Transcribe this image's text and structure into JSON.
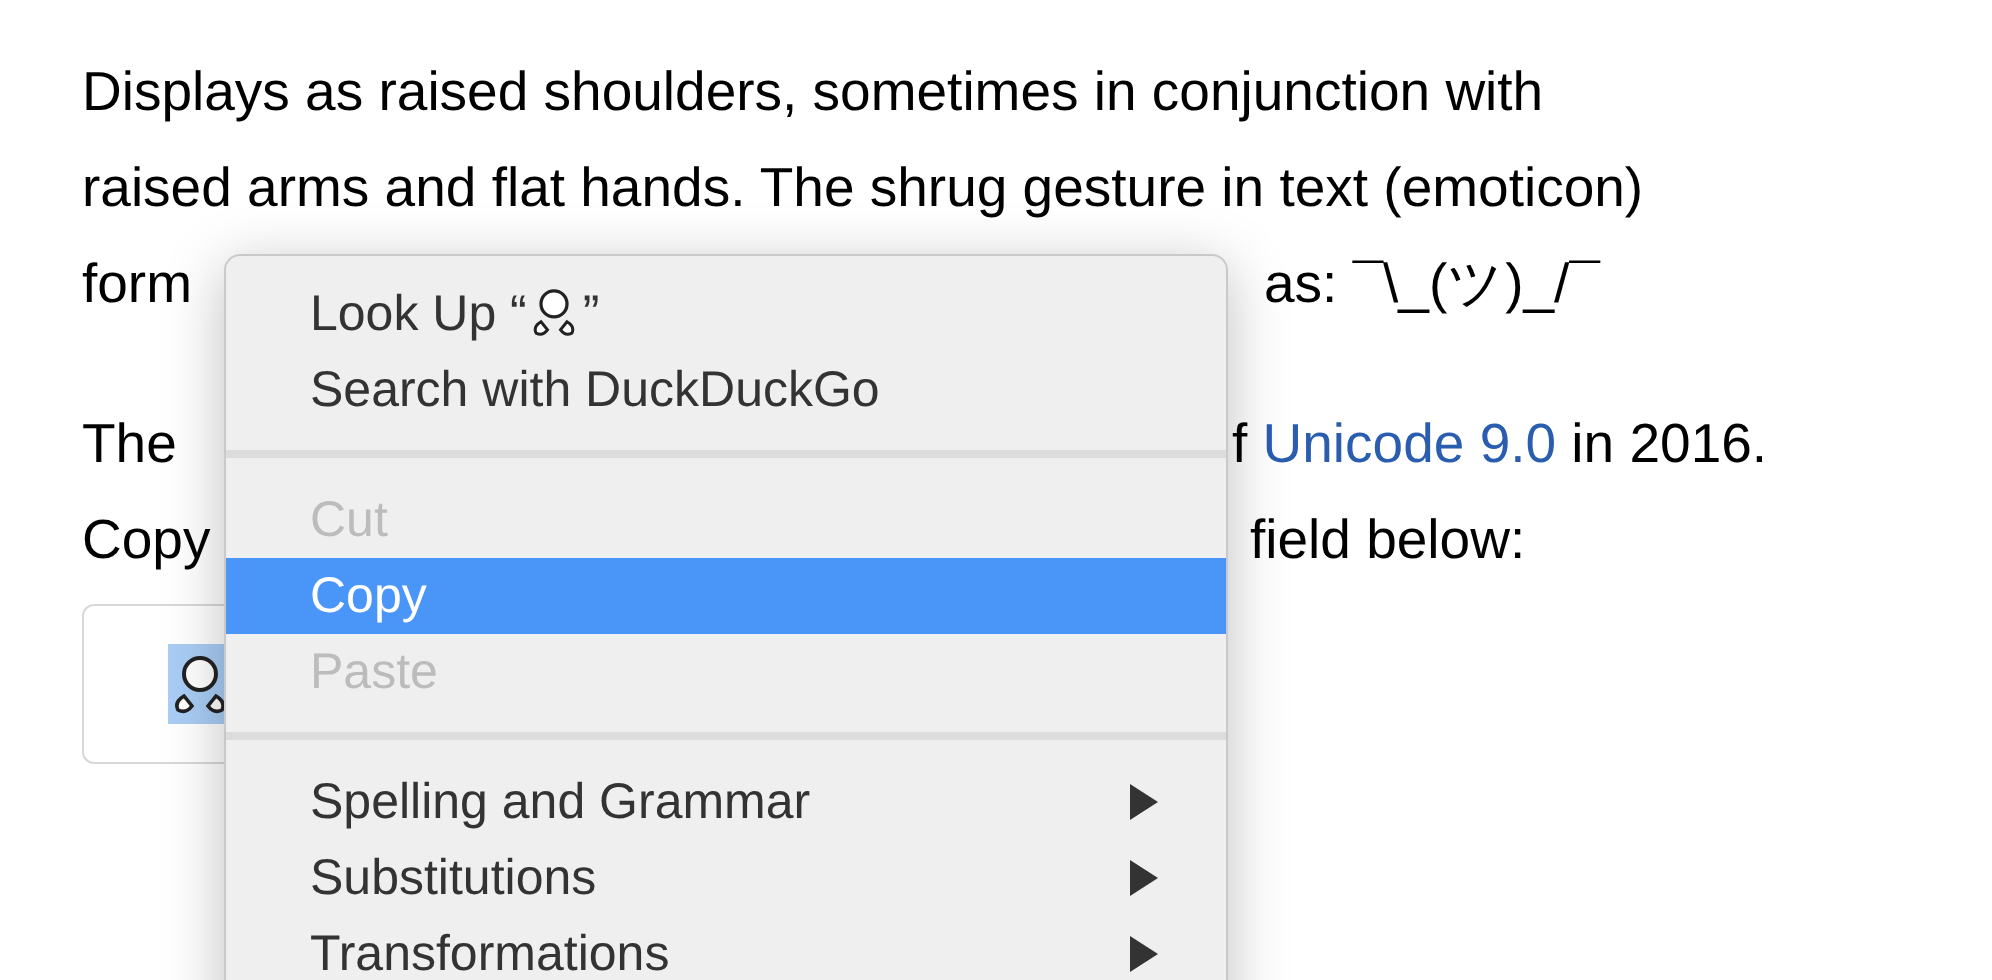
{
  "article": {
    "lines": [
      {
        "kind": "full",
        "text": "Displays as raised shoulders, sometimes in conjunction with"
      },
      {
        "kind": "full",
        "text": "raised arms and flat hands. The shrug gesture in text (emoticon)"
      },
      {
        "kind": "split",
        "left": "form",
        "right": "as: ¯\\_(ツ)_/¯"
      },
      {
        "kind": "split",
        "left": "The",
        "right_before": "f ",
        "link": "Unicode 9.0",
        "right": " in 2016."
      },
      {
        "kind": "split",
        "left": "Copy",
        "right": "field below:"
      }
    ]
  },
  "copy_field": {
    "selected": true
  },
  "context_menu": {
    "items": [
      {
        "kind": "lookup",
        "before": "Look Up “",
        "after": "”",
        "disabled": false,
        "selected": false
      },
      {
        "kind": "item",
        "label": "Search with DuckDuckGo",
        "disabled": false,
        "selected": false
      },
      {
        "kind": "separator"
      },
      {
        "kind": "item",
        "label": "Cut",
        "disabled": true,
        "selected": false
      },
      {
        "kind": "item",
        "label": "Copy",
        "disabled": false,
        "selected": true
      },
      {
        "kind": "item",
        "label": "Paste",
        "disabled": true,
        "selected": false
      },
      {
        "kind": "separator"
      },
      {
        "kind": "submenu",
        "label": "Spelling and Grammar",
        "disabled": false,
        "selected": false
      },
      {
        "kind": "submenu",
        "label": "Substitutions",
        "disabled": false,
        "selected": false
      },
      {
        "kind": "submenu",
        "label": "Transformations",
        "disabled": false,
        "selected": false
      }
    ]
  }
}
